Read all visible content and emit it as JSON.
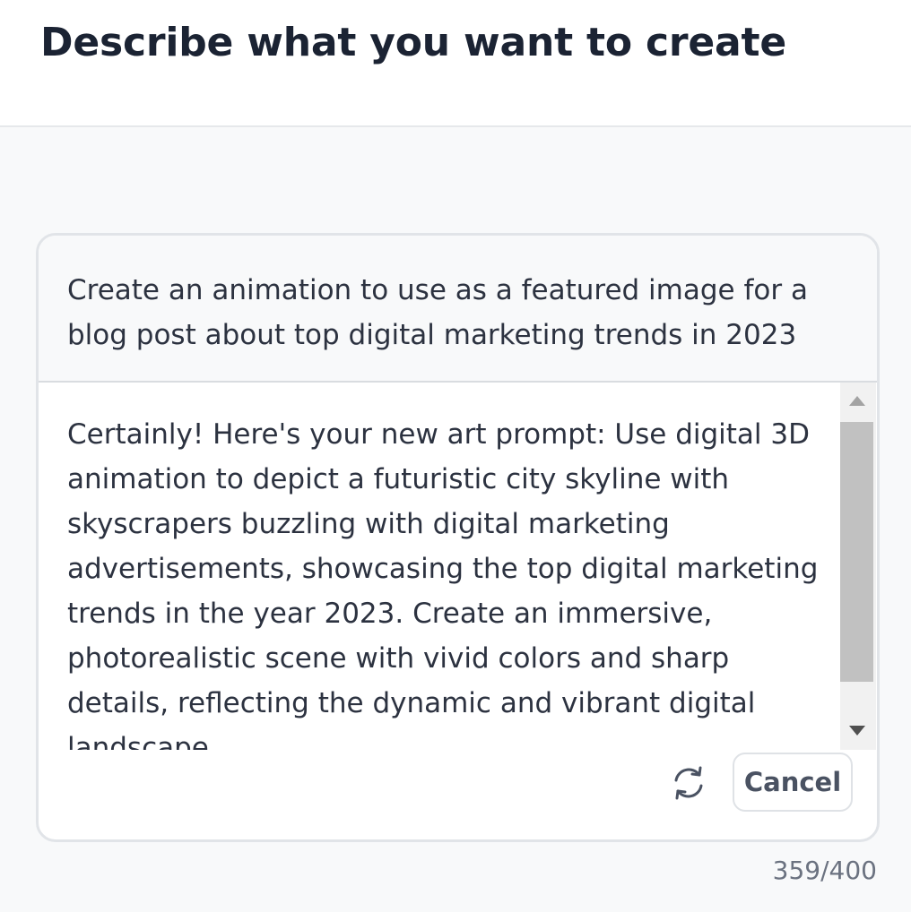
{
  "header": {
    "title": "Describe what you want to create"
  },
  "prompt": {
    "text": "Create an animation to use as a featured image for a blog post about top digital marketing trends in 2023"
  },
  "response": {
    "text": "Certainly! Here's your new art prompt: Use digital 3D animation to depict a futuristic city skyline with skyscrapers buzzling with digital marketing advertisements, showcasing the top digital marketing trends in the year 2023. Create an immersive, photorealistic scene with vivid colors and sharp details, reflecting the dynamic and vibrant digital landscape."
  },
  "actions": {
    "refresh_icon": "refresh-icon",
    "cancel_label": "Cancel"
  },
  "footer": {
    "char_count": "359/400"
  },
  "colors": {
    "title": "#1b2333",
    "body_text": "#2c3240",
    "page_background": "#f8f9fa",
    "card_border": "#e1e4e8",
    "muted_text": "#6b7280"
  }
}
